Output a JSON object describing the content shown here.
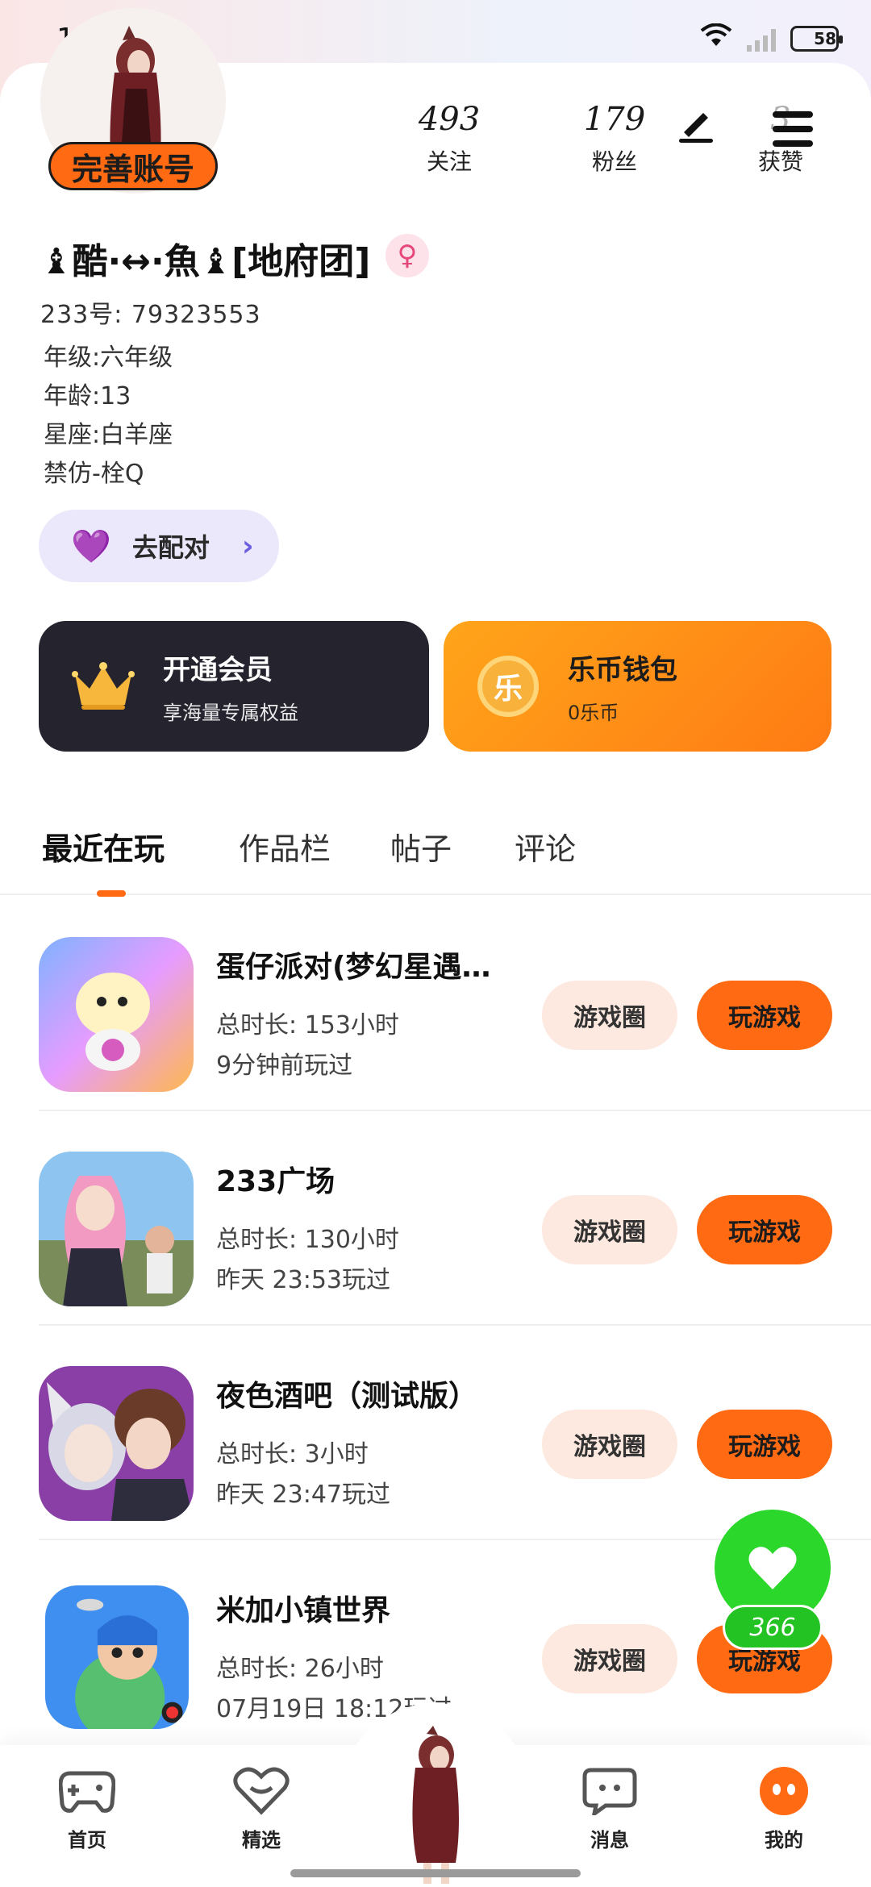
{
  "status_bar": {
    "time": "17:44",
    "battery": "58"
  },
  "profile": {
    "complete_account_label": "完善账号",
    "stats": [
      {
        "value": "493",
        "label": "关注"
      },
      {
        "value": "179",
        "label": "粉丝"
      },
      {
        "value": "3",
        "label": "获赞"
      }
    ],
    "nickname": "♝酷·↔·魚♝[地府团]",
    "uid": "233号: 79323553",
    "bio_lines": [
      "年级:六年级",
      "年龄:13",
      "星座:白羊座",
      "禁仿-栓Q"
    ],
    "gender_color": "#e6487c",
    "match_label": "去配对"
  },
  "cards": {
    "vip": {
      "title": "开通会员",
      "subtitle": "享海量专属权益"
    },
    "wallet": {
      "title": "乐币钱包",
      "subtitle": "0乐币",
      "coin_glyph": "乐"
    }
  },
  "tabs": [
    {
      "label": "最近在玩",
      "active": true
    },
    {
      "label": "作品栏",
      "active": false
    },
    {
      "label": "帖子",
      "active": false
    },
    {
      "label": "评论",
      "active": false
    }
  ],
  "games": [
    {
      "title": "蛋仔派对(梦幻星遇…",
      "playtime": "总时长: 153小时",
      "last_played": "9分钟前玩过",
      "circle_label": "游戏圈",
      "play_label": "玩游戏"
    },
    {
      "title": "233广场",
      "playtime": "总时长: 130小时",
      "last_played": "昨天 23:53玩过",
      "circle_label": "游戏圈",
      "play_label": "玩游戏"
    },
    {
      "title": "夜色酒吧（测试版）",
      "playtime": "总时长: 3小时",
      "last_played": "昨天 23:47玩过",
      "circle_label": "游戏圈",
      "play_label": "玩游戏"
    },
    {
      "title": "米加小镇世界",
      "playtime": "总时长: 26小时",
      "last_played": "07月19日 18:12玩过",
      "circle_label": "游戏圈",
      "play_label": "玩游戏"
    }
  ],
  "like_count": "366",
  "bottom_nav": [
    {
      "label": "首页",
      "icon": "gamepad-icon"
    },
    {
      "label": "精选",
      "icon": "heart-diamond-icon"
    },
    {
      "label": "消息",
      "icon": "chat-bubble-icon"
    },
    {
      "label": "我的",
      "icon": "profile-face-icon"
    }
  ],
  "colors": {
    "accent": "#ff6a13",
    "vip_card": "#25232d",
    "like_green": "#2bd72b",
    "match_bg": "#ebe8fb"
  }
}
